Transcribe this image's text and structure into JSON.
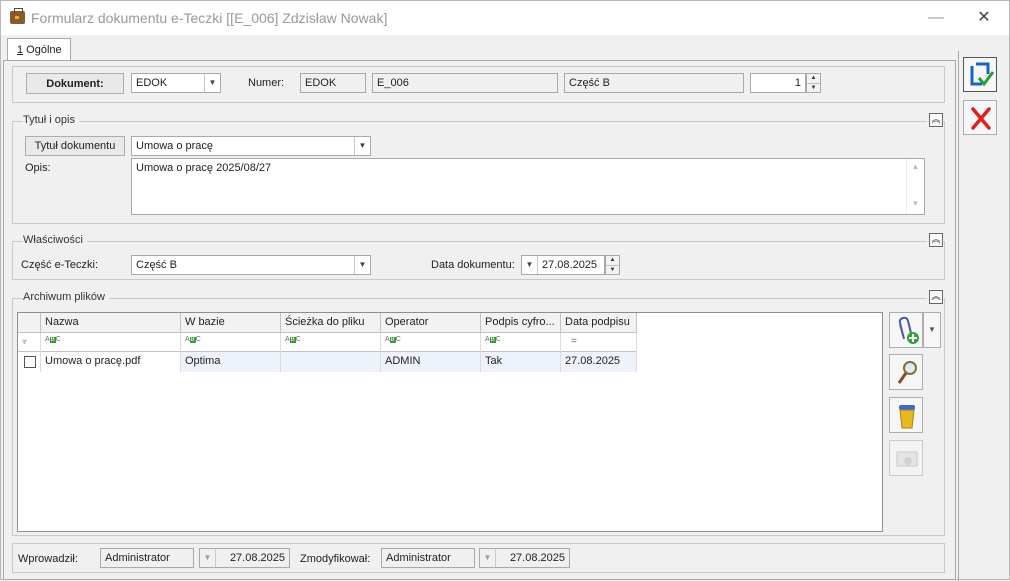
{
  "window": {
    "title": "Formularz dokumentu e-Teczki [[E_006] Zdzisław Nowak]",
    "minimize": "—",
    "close": "✕"
  },
  "tabs": [
    {
      "underline": "1",
      "label": " Ogólne"
    }
  ],
  "header": {
    "dokument_label": "Dokument:",
    "dokument_value": "EDOK",
    "numer_label": "Numer:",
    "numer_prefix": "EDOK",
    "numer_symbol": "E_006",
    "numer_part": "Część B",
    "numer_count": "1"
  },
  "tytul_section": {
    "title": "Tytuł i opis",
    "title_button": "Tytuł dokumentu",
    "title_value": "Umowa o pracę",
    "opis_label": "Opis:",
    "opis_value": "Umowa o pracę 2025/08/27"
  },
  "properties": {
    "title": "Właściwości",
    "czesc_label": "Część e-Teczki:",
    "czesc_value": "Część B",
    "data_label": "Data dokumentu:",
    "data_value": "27.08.2025"
  },
  "archive": {
    "title": "Archiwum plików",
    "columns": [
      "Nazwa",
      "W bazie",
      "Ścieżka do pliku",
      "Operator",
      "Podpis cyfro...",
      "Data podpisu"
    ],
    "filter_date": "=",
    "rows": [
      {
        "nazwa": "Umowa o  pracę.pdf",
        "w_bazie": "Optima",
        "sciezka": "",
        "operator": "ADMIN",
        "podpis": "Tak",
        "data_podpisu": "27.08.2025"
      }
    ]
  },
  "footer": {
    "wprowadzil_label": "Wprowadził:",
    "wprowadzil_user": "Administrator",
    "wprowadzil_date": "27.08.2025",
    "zmodyfikowal_label": "Zmodyfikował:",
    "zmodyfikowal_user": "Administrator",
    "zmodyfikowal_date": "27.08.2025"
  },
  "colors": {
    "save_blue": "#1b62c4",
    "cancel_red": "#e02020",
    "selected_row": "#eef2fb"
  }
}
